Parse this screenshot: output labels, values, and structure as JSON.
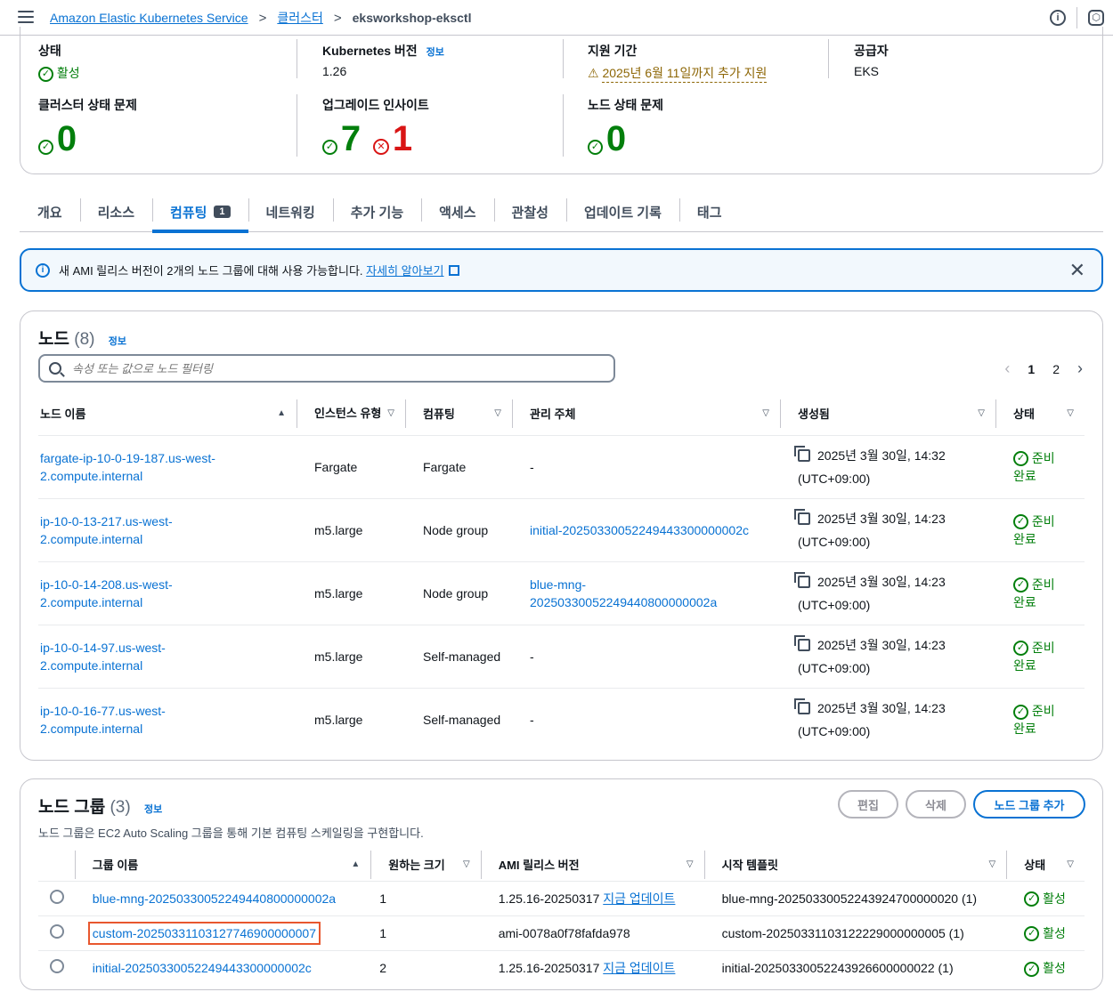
{
  "breadcrumb": {
    "service": "Amazon Elastic Kubernetes Service",
    "clusters": "클러스터",
    "current": "eksworkshop-eksctl"
  },
  "overview": {
    "status_label": "상태",
    "status_value": "활성",
    "k8s_label": "Kubernetes 버전",
    "k8s_info": "정보",
    "k8s_value": "1.26",
    "support_label": "지원 기간",
    "support_value": "2025년 6월 11일까지 추가 지원",
    "provider_label": "공급자",
    "provider_value": "EKS",
    "cluster_health_label": "클러스터 상태 문제",
    "cluster_health_value": "0",
    "upgrade_label": "업그레이드 인사이트",
    "upgrade_ok": "7",
    "upgrade_err": "1",
    "node_health_label": "노드 상태 문제",
    "node_health_value": "0"
  },
  "tabs": [
    {
      "label": "개요"
    },
    {
      "label": "리소스"
    },
    {
      "label": "컴퓨팅",
      "badge": "1"
    },
    {
      "label": "네트워킹"
    },
    {
      "label": "추가 기능"
    },
    {
      "label": "액세스"
    },
    {
      "label": "관찰성"
    },
    {
      "label": "업데이트 기록"
    },
    {
      "label": "태그"
    }
  ],
  "alert": {
    "text": "새 AMI 릴리스 버전이 2개의 노드 그룹에 대해 사용 가능합니다.",
    "link": "자세히 알아보기"
  },
  "nodes": {
    "title": "노드",
    "count": "(8)",
    "info": "정보",
    "search_placeholder": "속성 또는 값으로 노드 필터링",
    "pages": [
      "1",
      "2"
    ],
    "columns": [
      "노드 이름",
      "인스턴스 유형",
      "컴퓨팅",
      "관리 주체",
      "생성됨",
      "상태"
    ],
    "rows": [
      {
        "name1": "fargate-ip-10-0-19-187.us-west-",
        "name2": "2.compute.internal",
        "type": "Fargate",
        "compute": "Fargate",
        "managed1": "-",
        "managed2": "",
        "created1": "2025년 3월 30일, 14:32",
        "created2": "(UTC+09:00)",
        "status1": "준비",
        "status2": "완료"
      },
      {
        "name1": "ip-10-0-13-217.us-west-",
        "name2": "2.compute.internal",
        "type": "m5.large",
        "compute": "Node group",
        "managed1": "initial-20250330052249443300000002c",
        "managed2": "",
        "created1": "2025년 3월 30일, 14:23",
        "created2": "(UTC+09:00)",
        "status1": "준비",
        "status2": "완료"
      },
      {
        "name1": "ip-10-0-14-208.us-west-",
        "name2": "2.compute.internal",
        "type": "m5.large",
        "compute": "Node group",
        "managed1": "blue-mng-",
        "managed2": "20250330052249440800000002a",
        "created1": "2025년 3월 30일, 14:23",
        "created2": "(UTC+09:00)",
        "status1": "준비",
        "status2": "완료"
      },
      {
        "name1": "ip-10-0-14-97.us-west-",
        "name2": "2.compute.internal",
        "type": "m5.large",
        "compute": "Self-managed",
        "managed1": "-",
        "managed2": "",
        "created1": "2025년 3월 30일, 14:23",
        "created2": "(UTC+09:00)",
        "status1": "준비",
        "status2": "완료"
      },
      {
        "name1": "ip-10-0-16-77.us-west-",
        "name2": "2.compute.internal",
        "type": "m5.large",
        "compute": "Self-managed",
        "managed1": "-",
        "managed2": "",
        "created1": "2025년 3월 30일, 14:23",
        "created2": "(UTC+09:00)",
        "status1": "준비",
        "status2": "완료"
      }
    ]
  },
  "nodegroups": {
    "title": "노드 그룹",
    "count": "(3)",
    "info": "정보",
    "description": "노드 그룹은 EC2 Auto Scaling 그룹을 통해 기본 컴퓨팅 스케일링을 구현합니다.",
    "btn_edit": "편집",
    "btn_delete": "삭제",
    "btn_add": "노드 그룹 추가",
    "columns": [
      "그룹 이름",
      "원하는 크기",
      "AMI 릴리스 버전",
      "시작 템플릿",
      "상태"
    ],
    "rows": [
      {
        "name": "blue-mng-20250330052249440800000002a",
        "size": "1",
        "ami": "1.25.16-20250317",
        "ami_link": "지금 업데이트",
        "template": "blue-mng-20250330052243924700000020 (1)",
        "status": "활성"
      },
      {
        "name": "custom-20250331103127746900000007",
        "size": "1",
        "ami": "ami-0078a0f78fafda978",
        "ami_link": "",
        "template": "custom-20250331103122229000000005 (1)",
        "status": "활성"
      },
      {
        "name": "initial-20250330052249443300000002c",
        "size": "2",
        "ami": "1.25.16-20250317",
        "ami_link": "지금 업데이트",
        "template": "initial-20250330052243926600000022 (1)",
        "status": "활성"
      }
    ]
  },
  "colors": {
    "link": "#0972d3",
    "success": "#037f0c",
    "error": "#d91515",
    "highlight": "#e8572e"
  }
}
